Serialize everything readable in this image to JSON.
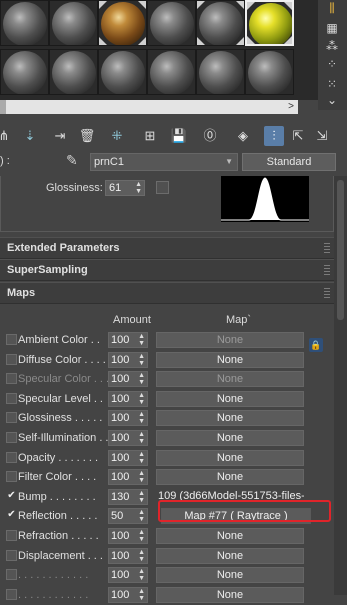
{
  "slots": {
    "row1": [
      "sphere",
      "sphere",
      "rust",
      "sphere",
      "sphere",
      "yellow"
    ],
    "row2": [
      "sphere",
      "sphere",
      "sphere",
      "sphere",
      "sphere",
      "sphere"
    ]
  },
  "hscroll_arrow": ">",
  "material": {
    "name": "prnC1",
    "type": "Standard",
    "prefix": ")  :"
  },
  "basic": {
    "glossiness_label": "Glossiness:",
    "glossiness_value": "61"
  },
  "rollouts": {
    "extended": "Extended Parameters",
    "supersampling": "SuperSampling",
    "maps": "Maps"
  },
  "maps_header": {
    "amount": "Amount",
    "map": "Map`"
  },
  "maps": [
    {
      "label": "Ambient Color . .",
      "checked": false,
      "amount": "100",
      "map": "None",
      "dim": false,
      "map_dim": true
    },
    {
      "label": "Diffuse Color . . . .",
      "checked": false,
      "amount": "100",
      "map": "None",
      "dim": false,
      "map_dim": false
    },
    {
      "label": "Specular Color . . .",
      "checked": false,
      "amount": "100",
      "map": "None",
      "dim": true,
      "map_dim": true
    },
    {
      "label": "Specular Level . .",
      "checked": false,
      "amount": "100",
      "map": "None",
      "dim": false,
      "map_dim": false
    },
    {
      "label": "Glossiness . . . . .",
      "checked": false,
      "amount": "100",
      "map": "None",
      "dim": false,
      "map_dim": false
    },
    {
      "label": "Self-Illumination . .",
      "checked": false,
      "amount": "100",
      "map": "None",
      "dim": false,
      "map_dim": false
    },
    {
      "label": "Opacity . . . . . . .",
      "checked": false,
      "amount": "100",
      "map": "None",
      "dim": false,
      "map_dim": false
    },
    {
      "label": "Filter Color . . . .",
      "checked": false,
      "amount": "100",
      "map": "None",
      "dim": false,
      "map_dim": false
    },
    {
      "label": "Bump . . . . . . . .",
      "checked": true,
      "amount": "130",
      "map": "109 (3d66Model-551753-files-8",
      "dim": false,
      "map_dim": false
    },
    {
      "label": "Reflection . . . . .",
      "checked": true,
      "amount": "50",
      "map": "Map #77  ( Raytrace )",
      "dim": false,
      "map_dim": false
    },
    {
      "label": "Refraction . . . . .",
      "checked": false,
      "amount": "100",
      "map": "None",
      "dim": false,
      "map_dim": false
    },
    {
      "label": "Displacement . . .",
      "checked": false,
      "amount": "100",
      "map": "None",
      "dim": false,
      "map_dim": false
    },
    {
      "label": ". . . . . . . . . . . .",
      "checked": false,
      "amount": "100",
      "map": "None",
      "dim": true,
      "map_dim": false
    },
    {
      "label": ". . . . . . . . . . . .",
      "checked": false,
      "amount": "100",
      "map": "None",
      "dim": true,
      "map_dim": false
    }
  ]
}
